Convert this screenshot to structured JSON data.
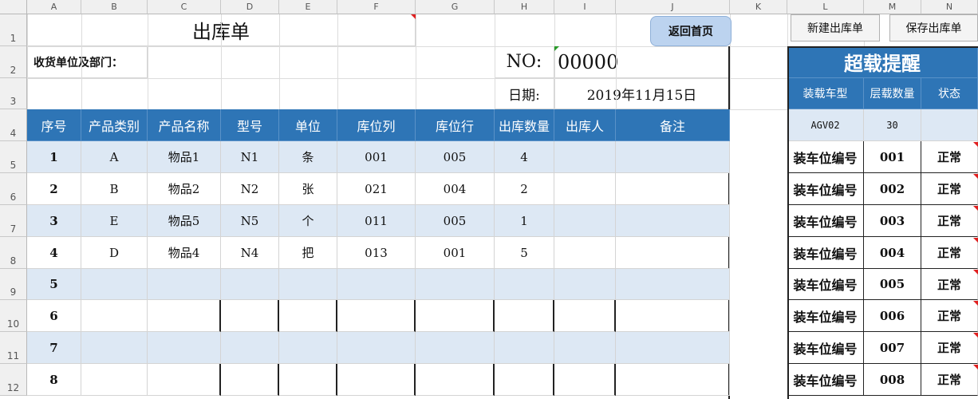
{
  "columns": [
    "A",
    "B",
    "C",
    "D",
    "E",
    "F",
    "G",
    "H",
    "I",
    "J",
    "K",
    "L",
    "M",
    "N"
  ],
  "rows": [
    "1",
    "2",
    "3",
    "4",
    "5",
    "6",
    "7",
    "8",
    "9",
    "10",
    "11",
    "12"
  ],
  "form": {
    "title": "出库单",
    "receiver_label": "收货单位及部门：",
    "no_label": "NO:",
    "no_value": "00000",
    "date_label": "日期:",
    "date_value": "2019年11月15日"
  },
  "buttons": {
    "home": "返回首页",
    "new": "新建出库单",
    "save": "保存出库单"
  },
  "table": {
    "headers": [
      "序号",
      "产品类别",
      "产品名称",
      "型号",
      "单位",
      "库位列",
      "库位行",
      "出库数量",
      "出库人",
      "备注"
    ],
    "rows": [
      [
        "1",
        "A",
        "物品1",
        "N1",
        "条",
        "001",
        "005",
        "4",
        "",
        ""
      ],
      [
        "2",
        "B",
        "物品2",
        "N2",
        "张",
        "021",
        "004",
        "2",
        "",
        ""
      ],
      [
        "3",
        "E",
        "物品5",
        "N5",
        "个",
        "011",
        "005",
        "1",
        "",
        ""
      ],
      [
        "4",
        "D",
        "物品4",
        "N4",
        "把",
        "013",
        "001",
        "5",
        "",
        ""
      ],
      [
        "5",
        "",
        "",
        "",
        "",
        "",
        "",
        "",
        "",
        ""
      ],
      [
        "6",
        "",
        "",
        "",
        "",
        "",
        "",
        "",
        "",
        ""
      ],
      [
        "7",
        "",
        "",
        "",
        "",
        "",
        "",
        "",
        "",
        ""
      ],
      [
        "8",
        "",
        "",
        "",
        "",
        "",
        "",
        "",
        "",
        ""
      ]
    ]
  },
  "overload": {
    "title": "超载提醒",
    "headers": [
      "装载车型",
      "层载数量",
      "状态"
    ],
    "vehicle": "AGV02",
    "layer_count": "30",
    "status_value": "",
    "rows": [
      {
        "label": "装车位编号",
        "code": "001",
        "status": "正常"
      },
      {
        "label": "装车位编号",
        "code": "002",
        "status": "正常"
      },
      {
        "label": "装车位编号",
        "code": "003",
        "status": "正常"
      },
      {
        "label": "装车位编号",
        "code": "004",
        "status": "正常"
      },
      {
        "label": "装车位编号",
        "code": "005",
        "status": "正常"
      },
      {
        "label": "装车位编号",
        "code": "006",
        "status": "正常"
      },
      {
        "label": "装车位编号",
        "code": "007",
        "status": "正常"
      },
      {
        "label": "装车位编号",
        "code": "008",
        "status": "正常"
      }
    ]
  },
  "colors": {
    "header_blue": "#2e75b6",
    "stripe": "#dde8f4",
    "button_blue": "#bcd3ef",
    "comment_marker": "#e02020"
  }
}
